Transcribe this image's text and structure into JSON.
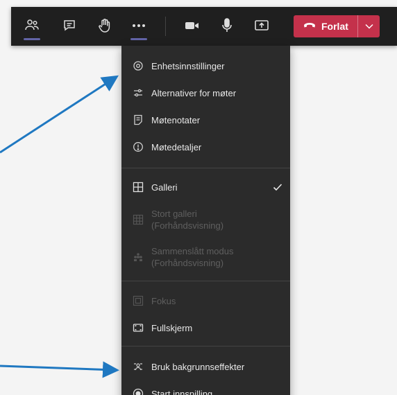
{
  "toolbar": {
    "icons": {
      "participants": "people-icon",
      "chat": "chat-icon",
      "raise_hand": "hand-icon",
      "more": "more-icon",
      "camera": "video-camera-icon",
      "mic": "microphone-icon",
      "share": "share-screen-icon"
    },
    "leave_label": "Forlat",
    "leave_color": "#c4314b",
    "accent_color": "#6264a7"
  },
  "menu": {
    "items": [
      {
        "label": "Enhetsinnstillinger",
        "icon": "settings-icon",
        "enabled": true
      },
      {
        "label": "Alternativer for møter",
        "icon": "sliders-icon",
        "enabled": true
      },
      {
        "label": "Møtenotater",
        "icon": "notes-icon",
        "enabled": true
      },
      {
        "label": "Møtedetaljer",
        "icon": "info-icon",
        "enabled": true
      },
      {
        "label": "Galleri",
        "icon": "gallery-icon",
        "enabled": true,
        "checked": true
      },
      {
        "label": "Stort galleri",
        "sublabel": "(Forhåndsvisning)",
        "icon": "large-gallery-icon",
        "enabled": false
      },
      {
        "label": "Sammenslått modus",
        "sublabel": "(Forhåndsvisning)",
        "icon": "together-mode-icon",
        "enabled": false
      },
      {
        "label": "Fokus",
        "icon": "focus-icon",
        "enabled": false
      },
      {
        "label": "Fullskjerm",
        "icon": "fullscreen-icon",
        "enabled": true
      },
      {
        "label": "Bruk bakgrunnseffekter",
        "icon": "background-effects-icon",
        "enabled": true
      },
      {
        "label": "Start innspilling",
        "icon": "record-icon",
        "enabled": true
      }
    ]
  },
  "annotation_color": "#1f78c1"
}
